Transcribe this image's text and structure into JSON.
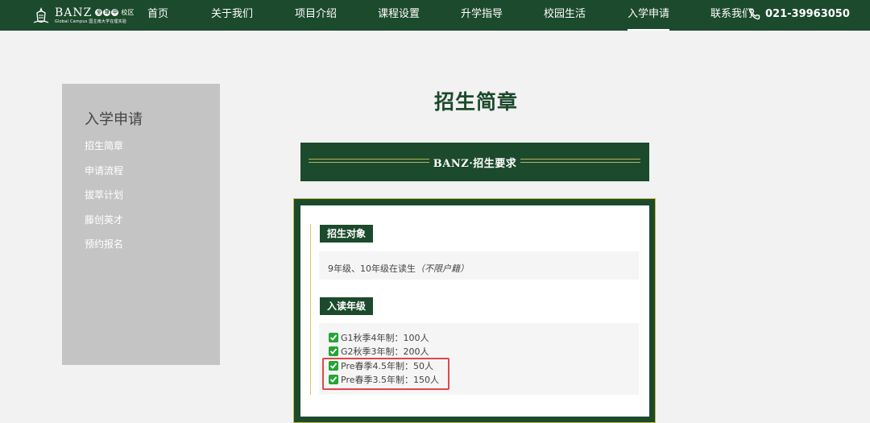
{
  "logo": {
    "brand": "BANZ",
    "dots": [
      "全",
      "球",
      "中"
    ],
    "campus": "校区",
    "tagline_en": "Global Campus",
    "tagline_cn": "国主南大学在理实验"
  },
  "nav": {
    "items": [
      {
        "label": "首页"
      },
      {
        "label": "关于我们"
      },
      {
        "label": "项目介绍"
      },
      {
        "label": "课程设置"
      },
      {
        "label": "升学指导"
      },
      {
        "label": "校园生活"
      },
      {
        "label": "入学申请"
      },
      {
        "label": "联系我们"
      }
    ],
    "active": "入学申请",
    "phone": "021-39963050"
  },
  "sidebar": {
    "title": "入学申请",
    "items": [
      {
        "label": "招生简章"
      },
      {
        "label": "申请流程"
      },
      {
        "label": "拔萃计划"
      },
      {
        "label": "藤创英才"
      },
      {
        "label": "预约报名"
      }
    ]
  },
  "main": {
    "title": "招生简章",
    "banner": "BANZ·招生要求",
    "section1": {
      "tag": "招生对象",
      "text": "9年级、10年级在读生",
      "note": "（不限户籍）"
    },
    "section2": {
      "tag": "入读年级",
      "grades": [
        {
          "label": "G1秋季4年制：100人"
        },
        {
          "label": "G2秋季3年制：200人"
        },
        {
          "label": "Pre春季4.5年制：50人"
        },
        {
          "label": "Pre春季3.5年制：150人"
        }
      ]
    }
  },
  "colors": {
    "brand_green": "#1c4a2c",
    "gold": "#c5b640",
    "check_green": "#22a534",
    "highlight_red": "#e04848",
    "sidebar_gray": "#c4c4c4"
  }
}
